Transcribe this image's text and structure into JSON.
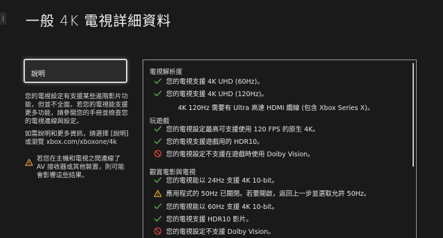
{
  "page": {
    "title": "一般 4K 電視詳細資料"
  },
  "left": {
    "explain_button": "說明",
    "para1": "您的電視設定有支援某些進階影片功能，但並不全面。若您的電視能支援更多功能，請參閱您的手冊並檢查您的電視連線與設定。",
    "para2": "如需說明和更多資訊，請選擇 [說明] 或瀏覽 xbox.com/xboxone/4k",
    "warning": "若您在主機和電視之間連線了 AV 接收器或其他裝置，則可能會影響這些結果。"
  },
  "panel": {
    "sections": {
      "resolution": "電視解析度",
      "gaming": "玩遊戲",
      "movies": "觀賞電影與電視"
    },
    "items": [
      {
        "icon": "check-icon",
        "text": "您的電視支援 4K UHD (60Hz)。"
      },
      {
        "icon": "check-icon",
        "text": "您的電視支援 4K UHD (120Hz)。"
      },
      {
        "text": "4K 120Hz 需要有 Ultra 高速 HDMI 纜線 (包含 Xbox Series X)。"
      },
      {
        "icon": "check-icon",
        "text": "您的電視設定最高可支援使用 120 FPS 的原生 4K。"
      },
      {
        "icon": "check-icon",
        "text": "您的電視支援遊戲用的 HDR10。"
      },
      {
        "icon": "blocked-icon",
        "text": "您的電視設定不支援在遊戲時使用 Dolby Vision。"
      },
      {
        "icon": "check-icon",
        "text": "您的電視能以 24Hz 支援 4K 10-bit。"
      },
      {
        "icon": "warning-icon",
        "text": "應用程式的 50Hz 已關閉。若要開啟，返回上一步並選取允許 50Hz。"
      },
      {
        "icon": "check-icon",
        "text": "您的電視能以 60Hz 支援 4K 10-bit。"
      },
      {
        "icon": "check-icon",
        "text": "您的電視支援 HDR10 影片。"
      },
      {
        "icon": "blocked-icon",
        "text": "您的電視設定不支援 Dolby Vision。"
      }
    ]
  },
  "colors": {
    "check": "#4fae4f",
    "warning": "#e0a030",
    "blocked": "#d9463b"
  }
}
